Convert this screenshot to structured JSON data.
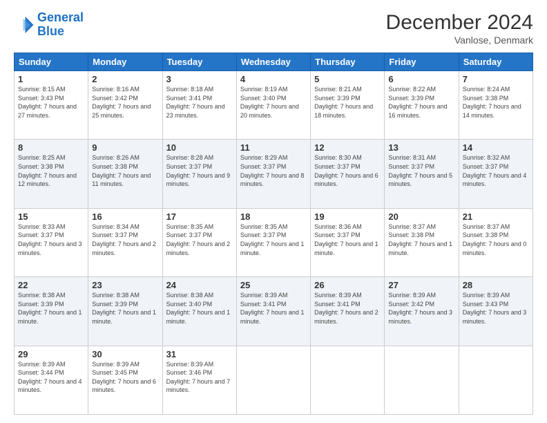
{
  "logo": {
    "line1": "General",
    "line2": "Blue"
  },
  "title": "December 2024",
  "subtitle": "Vanlose, Denmark",
  "days_header": [
    "Sunday",
    "Monday",
    "Tuesday",
    "Wednesday",
    "Thursday",
    "Friday",
    "Saturday"
  ],
  "weeks": [
    [
      {
        "day": "1",
        "sunrise": "8:15 AM",
        "sunset": "3:43 PM",
        "daylight": "7 hours and 27 minutes."
      },
      {
        "day": "2",
        "sunrise": "8:16 AM",
        "sunset": "3:42 PM",
        "daylight": "7 hours and 25 minutes."
      },
      {
        "day": "3",
        "sunrise": "8:18 AM",
        "sunset": "3:41 PM",
        "daylight": "7 hours and 23 minutes."
      },
      {
        "day": "4",
        "sunrise": "8:19 AM",
        "sunset": "3:40 PM",
        "daylight": "7 hours and 20 minutes."
      },
      {
        "day": "5",
        "sunrise": "8:21 AM",
        "sunset": "3:39 PM",
        "daylight": "7 hours and 18 minutes."
      },
      {
        "day": "6",
        "sunrise": "8:22 AM",
        "sunset": "3:39 PM",
        "daylight": "7 hours and 16 minutes."
      },
      {
        "day": "7",
        "sunrise": "8:24 AM",
        "sunset": "3:38 PM",
        "daylight": "7 hours and 14 minutes."
      }
    ],
    [
      {
        "day": "8",
        "sunrise": "8:25 AM",
        "sunset": "3:38 PM",
        "daylight": "7 hours and 12 minutes."
      },
      {
        "day": "9",
        "sunrise": "8:26 AM",
        "sunset": "3:38 PM",
        "daylight": "7 hours and 11 minutes."
      },
      {
        "day": "10",
        "sunrise": "8:28 AM",
        "sunset": "3:37 PM",
        "daylight": "7 hours and 9 minutes."
      },
      {
        "day": "11",
        "sunrise": "8:29 AM",
        "sunset": "3:37 PM",
        "daylight": "7 hours and 8 minutes."
      },
      {
        "day": "12",
        "sunrise": "8:30 AM",
        "sunset": "3:37 PM",
        "daylight": "7 hours and 6 minutes."
      },
      {
        "day": "13",
        "sunrise": "8:31 AM",
        "sunset": "3:37 PM",
        "daylight": "7 hours and 5 minutes."
      },
      {
        "day": "14",
        "sunrise": "8:32 AM",
        "sunset": "3:37 PM",
        "daylight": "7 hours and 4 minutes."
      }
    ],
    [
      {
        "day": "15",
        "sunrise": "8:33 AM",
        "sunset": "3:37 PM",
        "daylight": "7 hours and 3 minutes."
      },
      {
        "day": "16",
        "sunrise": "8:34 AM",
        "sunset": "3:37 PM",
        "daylight": "7 hours and 2 minutes."
      },
      {
        "day": "17",
        "sunrise": "8:35 AM",
        "sunset": "3:37 PM",
        "daylight": "7 hours and 2 minutes."
      },
      {
        "day": "18",
        "sunrise": "8:35 AM",
        "sunset": "3:37 PM",
        "daylight": "7 hours and 1 minute."
      },
      {
        "day": "19",
        "sunrise": "8:36 AM",
        "sunset": "3:37 PM",
        "daylight": "7 hours and 1 minute."
      },
      {
        "day": "20",
        "sunrise": "8:37 AM",
        "sunset": "3:38 PM",
        "daylight": "7 hours and 1 minute."
      },
      {
        "day": "21",
        "sunrise": "8:37 AM",
        "sunset": "3:38 PM",
        "daylight": "7 hours and 0 minutes."
      }
    ],
    [
      {
        "day": "22",
        "sunrise": "8:38 AM",
        "sunset": "3:39 PM",
        "daylight": "7 hours and 1 minute."
      },
      {
        "day": "23",
        "sunrise": "8:38 AM",
        "sunset": "3:39 PM",
        "daylight": "7 hours and 1 minute."
      },
      {
        "day": "24",
        "sunrise": "8:38 AM",
        "sunset": "3:40 PM",
        "daylight": "7 hours and 1 minute."
      },
      {
        "day": "25",
        "sunrise": "8:39 AM",
        "sunset": "3:41 PM",
        "daylight": "7 hours and 1 minute."
      },
      {
        "day": "26",
        "sunrise": "8:39 AM",
        "sunset": "3:41 PM",
        "daylight": "7 hours and 2 minutes."
      },
      {
        "day": "27",
        "sunrise": "8:39 AM",
        "sunset": "3:42 PM",
        "daylight": "7 hours and 3 minutes."
      },
      {
        "day": "28",
        "sunrise": "8:39 AM",
        "sunset": "3:43 PM",
        "daylight": "7 hours and 3 minutes."
      }
    ],
    [
      {
        "day": "29",
        "sunrise": "8:39 AM",
        "sunset": "3:44 PM",
        "daylight": "7 hours and 4 minutes."
      },
      {
        "day": "30",
        "sunrise": "8:39 AM",
        "sunset": "3:45 PM",
        "daylight": "7 hours and 6 minutes."
      },
      {
        "day": "31",
        "sunrise": "8:39 AM",
        "sunset": "3:46 PM",
        "daylight": "7 hours and 7 minutes."
      },
      null,
      null,
      null,
      null
    ]
  ]
}
